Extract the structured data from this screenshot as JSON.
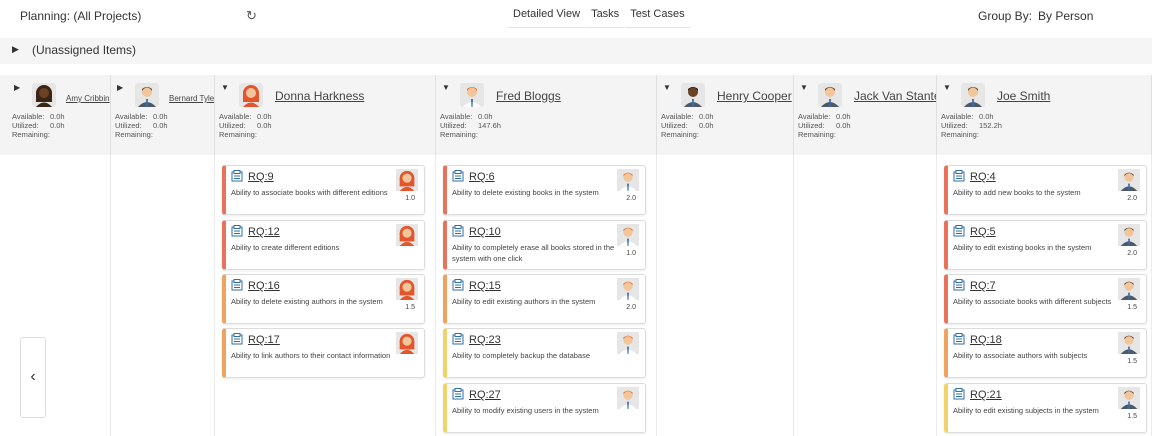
{
  "topbar": {
    "planning": "Planning: (All Projects)",
    "refresh_icon": "refresh-icon",
    "views": [
      "Detailed View",
      "Tasks",
      "Test Cases"
    ],
    "group_by_label": "Group By:",
    "group_by_value": "By Person"
  },
  "unassigned": {
    "label": "(Unassigned Items)"
  },
  "stat_labels": {
    "available": "Available:",
    "utilized": "Utilized:",
    "remaining": "Remaining:"
  },
  "colors": {
    "high": "#e8735d",
    "medium": "#f0a35e",
    "low": "#f2d36b"
  },
  "people": [
    {
      "name": "Amy Cribbin",
      "avatar": "female-dark",
      "available": "0.0h",
      "utilized": "0.0h",
      "remaining": "",
      "cards": []
    },
    {
      "name": "Bernard Tyler",
      "avatar": "male-suit",
      "available": "0.0h",
      "utilized": "0.0h",
      "remaining": "",
      "cards": []
    },
    {
      "name": "Donna Harkness",
      "avatar": "female-red",
      "available": "0.0h",
      "utilized": "0.0h",
      "remaining": "",
      "cards": [
        {
          "id": "RQ:9",
          "desc": "Ability to associate books with different editions",
          "est": "1.0",
          "priority": "high"
        },
        {
          "id": "RQ:12",
          "desc": "Ability to create different editions",
          "est": "",
          "priority": "high"
        },
        {
          "id": "RQ:16",
          "desc": "Ability to delete existing authors in the system",
          "est": "1.5",
          "priority": "medium"
        },
        {
          "id": "RQ:17",
          "desc": "Ability to link authors to their contact information",
          "est": "",
          "priority": "medium"
        }
      ]
    },
    {
      "name": "Fred Bloggs",
      "avatar": "male-orange",
      "available": "0.0h",
      "utilized": "147.6h",
      "remaining": "",
      "cards": [
        {
          "id": "RQ:6",
          "desc": "Ability to delete existing books in the system",
          "est": "2.0",
          "priority": "high"
        },
        {
          "id": "RQ:10",
          "desc": "Ability to completely erase all books stored in the system with one click",
          "est": "1.0",
          "priority": "high"
        },
        {
          "id": "RQ:15",
          "desc": "Ability to edit existing authors in the system",
          "est": "2.0",
          "priority": "medium"
        },
        {
          "id": "RQ:23",
          "desc": "Ability to completely backup the database",
          "est": "",
          "priority": "low"
        },
        {
          "id": "RQ:27",
          "desc": "Ability to modify existing users in the system",
          "est": "",
          "priority": "low"
        }
      ]
    },
    {
      "name": "Henry Cooper",
      "avatar": "male-dark",
      "available": "0.0h",
      "utilized": "0.0h",
      "remaining": "",
      "cards": []
    },
    {
      "name": "Jack Van Stanten",
      "avatar": "male-suit",
      "available": "0.0h",
      "utilized": "0.0h",
      "remaining": "",
      "cards": []
    },
    {
      "name": "Joe Smith",
      "avatar": "male-suit",
      "available": "0.0h",
      "utilized": "152.2h",
      "remaining": "",
      "cards": [
        {
          "id": "RQ:4",
          "desc": "Ability to add new books to the system",
          "est": "2.0",
          "priority": "high"
        },
        {
          "id": "RQ:5",
          "desc": "Ability to edit existing books in the system",
          "est": "2.0",
          "priority": "high"
        },
        {
          "id": "RQ:7",
          "desc": "Ability to associate books with different subjects",
          "est": "1.5",
          "priority": "high"
        },
        {
          "id": "RQ:18",
          "desc": "Ability to associate authors with subjects",
          "est": "1.5",
          "priority": "medium"
        },
        {
          "id": "RQ:21",
          "desc": "Ability to edit existing subjects in the system",
          "est": "1.5",
          "priority": "low"
        }
      ]
    }
  ],
  "nav": {
    "prev_icon": "chevron-left-icon",
    "prev_glyph": "‹"
  }
}
